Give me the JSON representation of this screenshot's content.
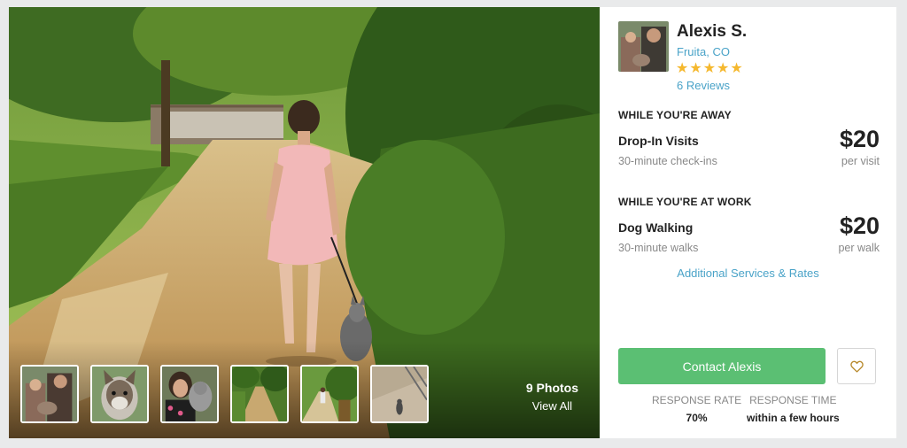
{
  "gallery": {
    "photo_count": "9 Photos",
    "view_all": "View All",
    "thumbnails": [
      "thumb-people-dog",
      "thumb-husky",
      "thumb-selfie-dog",
      "thumb-trail",
      "thumb-path",
      "thumb-bridge-dog"
    ]
  },
  "sitter": {
    "name": "Alexis S.",
    "location": "Fruita, CO",
    "rating": 5,
    "stars": "★★★★★",
    "reviews": "6 Reviews"
  },
  "services": [
    {
      "section": "WHILE YOU'RE AWAY",
      "name": "Drop-In Visits",
      "description": "30-minute check-ins",
      "price": "$20",
      "unit": "per visit"
    },
    {
      "section": "WHILE YOU'RE AT WORK",
      "name": "Dog Walking",
      "description": "30-minute walks",
      "price": "$20",
      "unit": "per walk"
    }
  ],
  "additional_link": "Additional Services & Rates",
  "actions": {
    "contact": "Contact Alexis",
    "favorite_icon": "heart-outline-icon"
  },
  "stats": {
    "response_rate_label": "RESPONSE RATE",
    "response_rate": "70%",
    "response_time_label": "RESPONSE TIME",
    "response_time": "within a few hours"
  },
  "colors": {
    "accent_blue": "#4aa3c8",
    "contact_green": "#5bbf73",
    "star_gold": "#f5b82e"
  }
}
